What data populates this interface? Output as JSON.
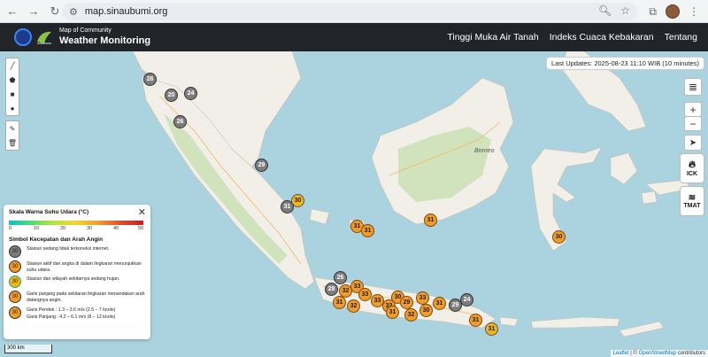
{
  "browser": {
    "url": "map.sinaubumi.org"
  },
  "header": {
    "brand_small": "Map of Community",
    "brand_title": "Weather Monitoring",
    "nav": [
      "Tinggi Muka Air Tanah",
      "Indeks Cuaca Kebakaran",
      "Tentang"
    ]
  },
  "map": {
    "last_update": "Last Updates: 2025-08-23 11:10 WIB (10 minutes)",
    "ctrl_fire_label": "ICK",
    "ctrl_water_label": "TMAT",
    "scale_label": "300 km",
    "attribution_leaflet": "Leaflet",
    "attribution_sep": " | © ",
    "attribution_osm": "OpenStreetMap",
    "attribution_tail": " contributors",
    "place_label": "Borneo",
    "stations_grey": [
      "26",
      "20",
      "24",
      "26",
      "29",
      "31",
      "26",
      "28",
      "24",
      "29"
    ],
    "stations_orange": [
      "30",
      "31",
      "31",
      "31",
      "30",
      "32",
      "33",
      "33",
      "31",
      "32",
      "33",
      "33",
      "30",
      "31",
      "29",
      "32",
      "33",
      "30",
      "31",
      "31"
    ]
  },
  "legend": {
    "title": "Skala Warna Suhu Udara (°C)",
    "scale_ticks": [
      "0",
      "10",
      "20",
      "30",
      "40",
      "50"
    ],
    "wind_title": "Simbol Kecepatan dan Arah Angin",
    "items": [
      {
        "icon": "30",
        "text": "Stasiun sedang tidak terkoneksi internet."
      },
      {
        "icon": "30",
        "text": "Stasiun aktif dan angka di dalam lingkaran menunjukkan suhu udara."
      },
      {
        "icon": "30",
        "text": "Stasiun dan wilayah sekitarnya sedang hujan."
      },
      {
        "icon": "30",
        "text": "Garis panjang pada sekitaran lingkaran menandakan arah datangnya angin."
      }
    ],
    "wind_short": "Garis Pendek : 1.3 – 3.6 m/s (2.5 – 7 knots)",
    "wind_long": "Garis Panjang : 4.2 – 6.1 m/s (8 – 12 knots)"
  }
}
